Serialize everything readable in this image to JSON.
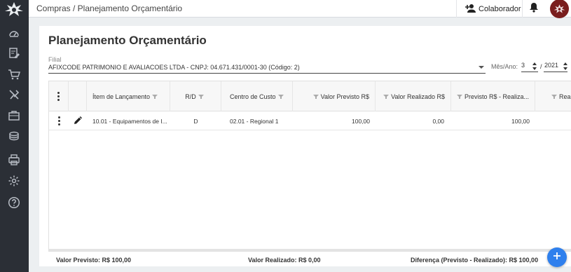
{
  "topbar": {
    "breadcrumb": "Compras / Planejamento Orçamentário",
    "collaborator_label": "Colaborador"
  },
  "page": {
    "title": "Planejamento Orçamentário"
  },
  "filters": {
    "filial_label": "Filial",
    "filial_value": "AFIXCODE PATRIMONIO E AVALIACOES LTDA - CNPJ: 04.671.431/0001-30 (Código: 2)",
    "mesano_label": "Mês/Ano:",
    "month": "3",
    "slash": "/",
    "year": "2021"
  },
  "grid": {
    "headers": {
      "item": "Ítem de Lançamento",
      "rd": "R/D",
      "centro": "Centro de Custo",
      "valor_previsto": "Valor Previsto R$",
      "valor_realizado": "Valor Realizado R$",
      "previsto_realizado": "Previsto R$ - Realiza...",
      "extra": "Real"
    },
    "rows": [
      {
        "item": "10.01 - Equipamentos de I...",
        "rd": "D",
        "centro": "02.01 - Regional 1",
        "valor_previsto": "100,00",
        "valor_realizado": "0,00",
        "previsto_realizado": "100,00"
      }
    ]
  },
  "totals": {
    "valor_previsto": "Valor Previsto: R$ 100,00",
    "valor_realizado": "Valor Realizado: R$ 0,00",
    "diferenca": "Diferença (Previsto - Realizado): R$ 100,00"
  },
  "icons": {
    "sidebar": [
      "dashboard-icon",
      "edit-document-icon",
      "cart-icon",
      "tools-icon",
      "briefcase-icon",
      "coins-icon",
      "printer-icon",
      "settings-icon",
      "help-icon"
    ],
    "fab": "plus-icon"
  },
  "colors": {
    "sidebar": "#2b2f36",
    "accent": "#2f80ed",
    "avatar": "#7a1e1e"
  }
}
